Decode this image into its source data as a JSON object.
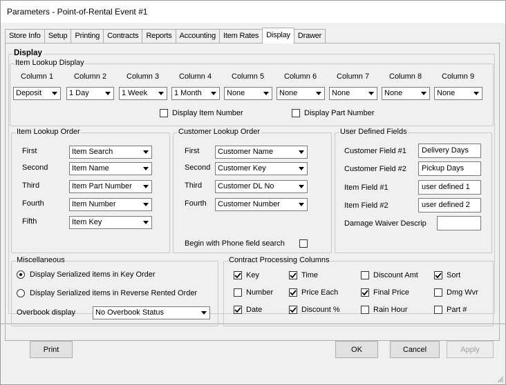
{
  "window": {
    "title": "Parameters - Point-of-Rental Event #1"
  },
  "tabs": [
    "Store Info",
    "Setup",
    "Printing",
    "Contracts",
    "Reports",
    "Accounting",
    "Item Rates",
    "Display",
    "Drawer"
  ],
  "active_tab": "Display",
  "display": {
    "legend": "Display",
    "item_lookup_display": {
      "legend": "Item Lookup Display",
      "columns": [
        {
          "label": "Column 1",
          "value": "Deposit"
        },
        {
          "label": "Column 2",
          "value": "1 Day"
        },
        {
          "label": "Column 3",
          "value": "1 Week"
        },
        {
          "label": "Column 4",
          "value": "1 Month"
        },
        {
          "label": "Column 5",
          "value": "None"
        },
        {
          "label": "Column 6",
          "value": "None"
        },
        {
          "label": "Column 7",
          "value": "None"
        },
        {
          "label": "Column 8",
          "value": "None"
        },
        {
          "label": "Column 9",
          "value": "None"
        }
      ],
      "display_item_number": {
        "label": "Display Item Number",
        "checked": false
      },
      "display_part_number": {
        "label": "Display Part Number",
        "checked": false
      }
    },
    "item_lookup_order": {
      "legend": "Item Lookup Order",
      "rows": [
        {
          "label": "First",
          "value": "Item Search"
        },
        {
          "label": "Second",
          "value": "Item Name"
        },
        {
          "label": "Third",
          "value": "Item Part Number"
        },
        {
          "label": "Fourth",
          "value": "Item Number"
        },
        {
          "label": "Fifth",
          "value": "Item Key"
        }
      ]
    },
    "customer_lookup_order": {
      "legend": "Customer Lookup Order",
      "rows": [
        {
          "label": "First",
          "value": "Customer Name"
        },
        {
          "label": "Second",
          "value": "Customer Key"
        },
        {
          "label": "Third",
          "value": "Customer DL No"
        },
        {
          "label": "Fourth",
          "value": "Customer Number"
        }
      ],
      "phone_search": {
        "label": "Begin with Phone field search",
        "checked": false
      }
    },
    "user_defined_fields": {
      "legend": "User Defined Fields",
      "rows": [
        {
          "label": "Customer Field #1",
          "value": "Delivery Days"
        },
        {
          "label": "Customer Field #2",
          "value": "Pickup Days"
        },
        {
          "label": "Item Field #1",
          "value": "user defined 1"
        },
        {
          "label": "Item Field #2",
          "value": "user defined 2"
        },
        {
          "label": "Damage Waiver Descrip",
          "value": ""
        }
      ]
    },
    "miscellaneous": {
      "legend": "Miscellaneous",
      "radios": [
        {
          "label": "Display Serialized items in Key Order",
          "selected": true
        },
        {
          "label": "Display Serialized items in Reverse Rented Order",
          "selected": false
        }
      ],
      "overbook_label": "Overbook display",
      "overbook_value": "No Overbook Status"
    },
    "contract_processing_columns": {
      "legend": "Contract Processing Columns",
      "items": [
        {
          "label": "Key",
          "checked": true
        },
        {
          "label": "Time",
          "checked": true
        },
        {
          "label": "Discount Amt",
          "checked": false
        },
        {
          "label": "Sort",
          "checked": true
        },
        {
          "label": "Number",
          "checked": false
        },
        {
          "label": "Price Each",
          "checked": true
        },
        {
          "label": "Final Price",
          "checked": true
        },
        {
          "label": "Dmg Wvr",
          "checked": false
        },
        {
          "label": "Date",
          "checked": true
        },
        {
          "label": "Discount %",
          "checked": true
        },
        {
          "label": "Rain Hour",
          "checked": false
        },
        {
          "label": "Part #",
          "checked": false
        }
      ]
    }
  },
  "buttons": {
    "print": "Print",
    "ok": "OK",
    "cancel": "Cancel",
    "apply": "Apply"
  }
}
